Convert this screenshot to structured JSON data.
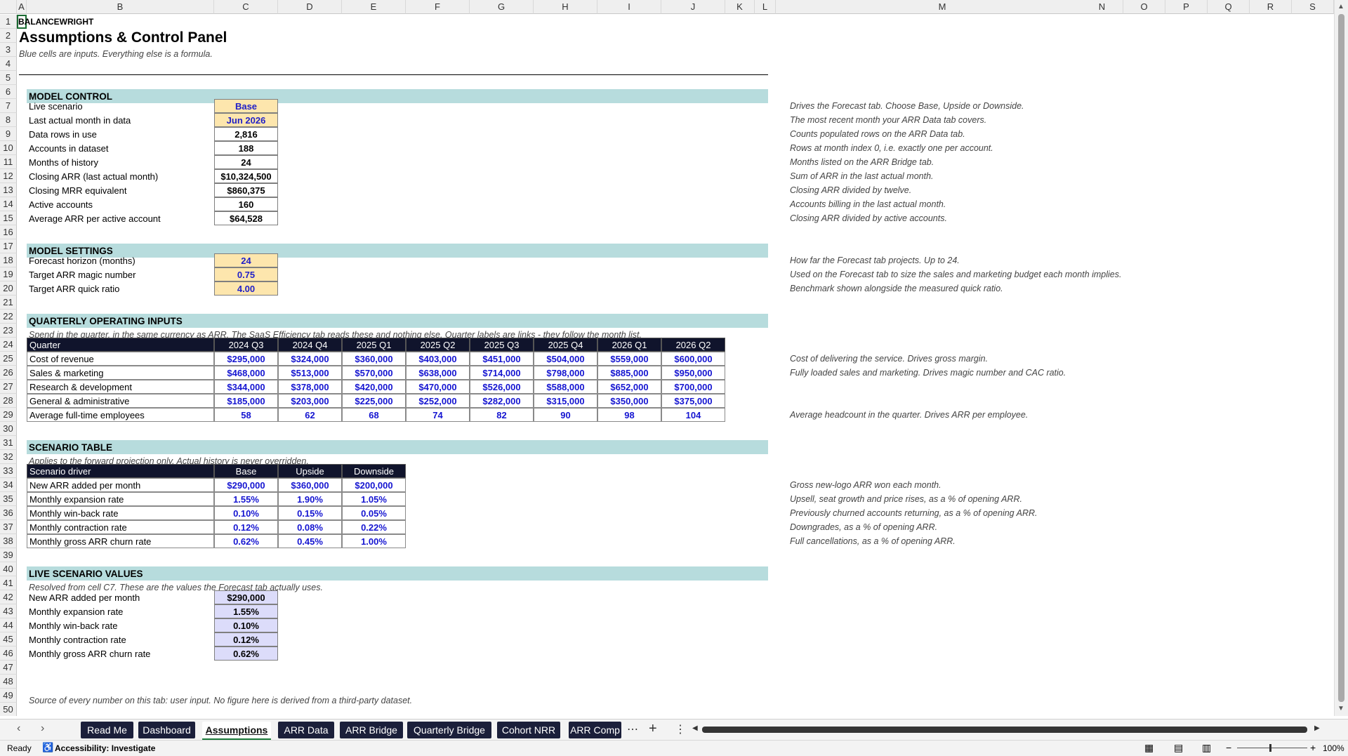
{
  "columns": [
    "A",
    "B",
    "C",
    "D",
    "E",
    "F",
    "G",
    "H",
    "I",
    "J",
    "K",
    "L",
    "M",
    "N",
    "O",
    "P",
    "Q",
    "R",
    "S"
  ],
  "rows": [
    "1",
    "2",
    "3",
    "4",
    "5",
    "6",
    "7",
    "8",
    "9",
    "10",
    "11",
    "12",
    "13",
    "14",
    "15",
    "16",
    "17",
    "18",
    "19",
    "20",
    "21",
    "22",
    "23",
    "24",
    "25",
    "26",
    "27",
    "28",
    "29",
    "30",
    "31",
    "32",
    "33",
    "34",
    "35",
    "36",
    "37",
    "38",
    "39",
    "40",
    "41",
    "42",
    "43",
    "44",
    "45",
    "46",
    "47",
    "48",
    "49",
    "50"
  ],
  "header": {
    "brand": "BALANCEWRIGHT",
    "title": "Assumptions & Control Panel",
    "subtitle": "Blue cells are inputs. Everything else is a formula."
  },
  "model_control": {
    "band": "MODEL CONTROL",
    "items": [
      {
        "label": "Live scenario",
        "value": "Base",
        "note": "Drives the Forecast tab. Choose Base, Upside or Downside."
      },
      {
        "label": "Last actual month in data",
        "value": "Jun 2026",
        "note": "The most recent month your ARR Data tab covers."
      },
      {
        "label": "Data rows in use",
        "value": "2,816",
        "note": "Counts populated rows on the ARR Data tab."
      },
      {
        "label": "Accounts in dataset",
        "value": "188",
        "note": "Rows at month index 0, i.e. exactly one per account."
      },
      {
        "label": "Months of history",
        "value": "24",
        "note": "Months listed on the ARR Bridge tab."
      },
      {
        "label": "Closing ARR (last actual month)",
        "value": "$10,324,500",
        "note": "Sum of ARR in the last actual month."
      },
      {
        "label": "Closing MRR equivalent",
        "value": "$860,375",
        "note": "Closing ARR divided by twelve."
      },
      {
        "label": "Active accounts",
        "value": "160",
        "note": "Accounts billing in the last actual month."
      },
      {
        "label": "Average ARR per active account",
        "value": "$64,528",
        "note": "Closing ARR divided by active accounts."
      }
    ]
  },
  "model_settings": {
    "band": "MODEL SETTINGS",
    "items": [
      {
        "label": "Forecast horizon (months)",
        "value": "24",
        "note": "How far the Forecast tab projects. Up to 24."
      },
      {
        "label": "Target ARR magic number",
        "value": "0.75",
        "note": "Used on the Forecast tab to size the sales and marketing budget each month implies."
      },
      {
        "label": "Target ARR quick ratio",
        "value": "4.00",
        "note": "Benchmark shown alongside the measured quick ratio."
      }
    ]
  },
  "quarterly": {
    "band": "QUARTERLY OPERATING INPUTS",
    "intro": "Spend in the quarter, in the same currency as ARR. The SaaS Efficiency tab reads these and nothing else. Quarter labels are links - they follow the month list.",
    "header_label": "Quarter",
    "quarters": [
      "2024 Q3",
      "2024 Q4",
      "2025 Q1",
      "2025 Q2",
      "2025 Q3",
      "2025 Q4",
      "2026 Q1",
      "2026 Q2"
    ],
    "rows": [
      {
        "label": "Cost of revenue",
        "values": [
          "$295,000",
          "$324,000",
          "$360,000",
          "$403,000",
          "$451,000",
          "$504,000",
          "$559,000",
          "$600,000"
        ],
        "note": "Cost of delivering the service. Drives gross margin."
      },
      {
        "label": "Sales & marketing",
        "values": [
          "$468,000",
          "$513,000",
          "$570,000",
          "$638,000",
          "$714,000",
          "$798,000",
          "$885,000",
          "$950,000"
        ],
        "note": "Fully loaded sales and marketing. Drives magic number and CAC ratio."
      },
      {
        "label": "Research & development",
        "values": [
          "$344,000",
          "$378,000",
          "$420,000",
          "$470,000",
          "$526,000",
          "$588,000",
          "$652,000",
          "$700,000"
        ],
        "note": ""
      },
      {
        "label": "General & administrative",
        "values": [
          "$185,000",
          "$203,000",
          "$225,000",
          "$252,000",
          "$282,000",
          "$315,000",
          "$350,000",
          "$375,000"
        ],
        "note": ""
      },
      {
        "label": "Average full-time employees",
        "values": [
          "58",
          "62",
          "68",
          "74",
          "82",
          "90",
          "98",
          "104"
        ],
        "note": "Average headcount in the quarter. Drives ARR per employee."
      }
    ]
  },
  "scenario": {
    "band": "SCENARIO TABLE",
    "intro": "Applies to the forward projection only. Actual history is never overridden.",
    "header_label": "Scenario driver",
    "columns": [
      "Base",
      "Upside",
      "Downside"
    ],
    "rows": [
      {
        "label": "New ARR added per month",
        "values": [
          "$290,000",
          "$360,000",
          "$200,000"
        ],
        "note": "Gross new-logo ARR won each month."
      },
      {
        "label": "Monthly expansion rate",
        "values": [
          "1.55%",
          "1.90%",
          "1.05%"
        ],
        "note": "Upsell, seat growth and price rises, as a % of opening ARR."
      },
      {
        "label": "Monthly win-back rate",
        "values": [
          "0.10%",
          "0.15%",
          "0.05%"
        ],
        "note": "Previously churned accounts returning, as a % of opening ARR."
      },
      {
        "label": "Monthly contraction rate",
        "values": [
          "0.12%",
          "0.08%",
          "0.22%"
        ],
        "note": "Downgrades, as a % of opening ARR."
      },
      {
        "label": "Monthly gross ARR churn rate",
        "values": [
          "0.62%",
          "0.45%",
          "1.00%"
        ],
        "note": "Full cancellations, as a % of opening ARR."
      }
    ]
  },
  "live_values": {
    "band": "LIVE SCENARIO VALUES",
    "intro": "Resolved from cell C7. These are the values the Forecast tab actually uses.",
    "items": [
      {
        "label": "New ARR added per month",
        "value": "$290,000"
      },
      {
        "label": "Monthly expansion rate",
        "value": "1.55%"
      },
      {
        "label": "Monthly win-back rate",
        "value": "0.10%"
      },
      {
        "label": "Monthly contraction rate",
        "value": "0.12%"
      },
      {
        "label": "Monthly gross ARR churn rate",
        "value": "0.62%"
      }
    ]
  },
  "source_note": "Source of every number on this tab: user input. No figure here is derived from a third-party dataset.",
  "tabs": [
    "Read Me",
    "Dashboard",
    "Assumptions",
    "ARR Data",
    "ARR Bridge",
    "Quarterly Bridge",
    "Cohort NRR",
    "ARR Comp"
  ],
  "active_tab": "Assumptions",
  "status": {
    "ready": "Ready",
    "accessibility": "Accessibility: Investigate",
    "zoom": "100%"
  },
  "colors": {
    "band": "#b7dcdd",
    "input": "#fde6ad",
    "header": "#10142c",
    "live": "#dcdcfa"
  }
}
